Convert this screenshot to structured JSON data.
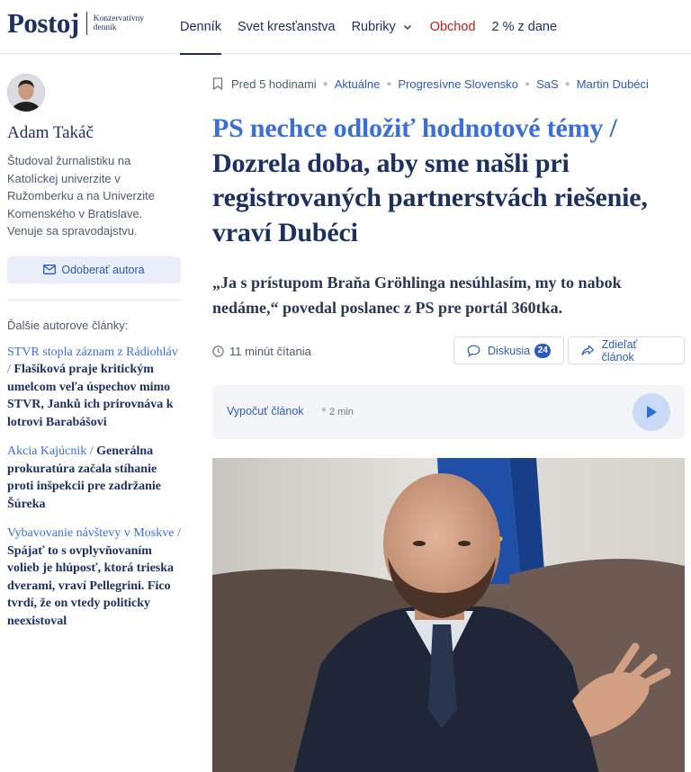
{
  "header": {
    "logo_text": "Postoj",
    "logo_tagline": "Konzervatívny denník",
    "nav": [
      {
        "label": "Denník",
        "active": true
      },
      {
        "label": "Svet kresťanstva"
      },
      {
        "label": "Rubriky",
        "has_dropdown": true
      },
      {
        "label": "Obchod",
        "color": "#b3201d"
      },
      {
        "label": "2 % z dane"
      }
    ]
  },
  "sidebar": {
    "author_name": "Adam Takáč",
    "author_bio": "Študoval žurnalistiku na Katolíckej univerzite v Ružomberku a na Univerzite Komenského v Bratislave. Venuje sa spravodajstvu.",
    "follow_label": "Odoberať autora",
    "more_label": "Ďalšie autorove články:",
    "articles": [
      {
        "kicker": "STVR stopla záznam z Rádiohláv /",
        "title": "Flašíková praje kritickým umelcom veľa úspechov mimo STVR, Janků ich prirovnáva k lotrovi Barabášovi"
      },
      {
        "kicker": "Akcia Kajúcnik /",
        "title": "Generálna prokuratúra začala stíhanie proti inšpekcii pre zadržanie Šúreka"
      },
      {
        "kicker": "Vybavovanie návštevy v Moskve /",
        "title": "Spájať to s ovplyvňovaním volieb je hlúposť, ktorá trieska dverami, vraví Pellegrini. Fico tvrdí, že on vtedy politicky neexistoval"
      }
    ]
  },
  "article": {
    "time": "Pred 5 hodinami",
    "tags": [
      "Aktuálne",
      "Progresívne Slovensko",
      "SaS",
      "Martin Dubéci"
    ],
    "title_kicker": "PS nechce odložiť hodnotové témy /",
    "title_main": "Dozrela doba, aby sme našli pri registrovaných partnerstvách riešenie, vraví Dubéci",
    "lead": "„Ja s prístupom Braňa Gröhlinga nesúhlasím, my to nabok nedáme,“ povedal poslanec z PS pre portál 360tka.",
    "read_time": "11 minút čítania",
    "discussion_label": "Diskusia",
    "discussion_count": "24",
    "share_label": "Zdieľať článok",
    "player_label": "Vypočuť článok",
    "player_duration": "2 min"
  },
  "colors": {
    "brand": "#1c3161",
    "accent": "#2d5bb8",
    "kicker": "#3a6fd8",
    "shop": "#b3201d"
  },
  "icons": [
    "bookmark-icon",
    "clock-icon",
    "chat-icon",
    "share-icon",
    "mail-icon",
    "play-icon"
  ]
}
